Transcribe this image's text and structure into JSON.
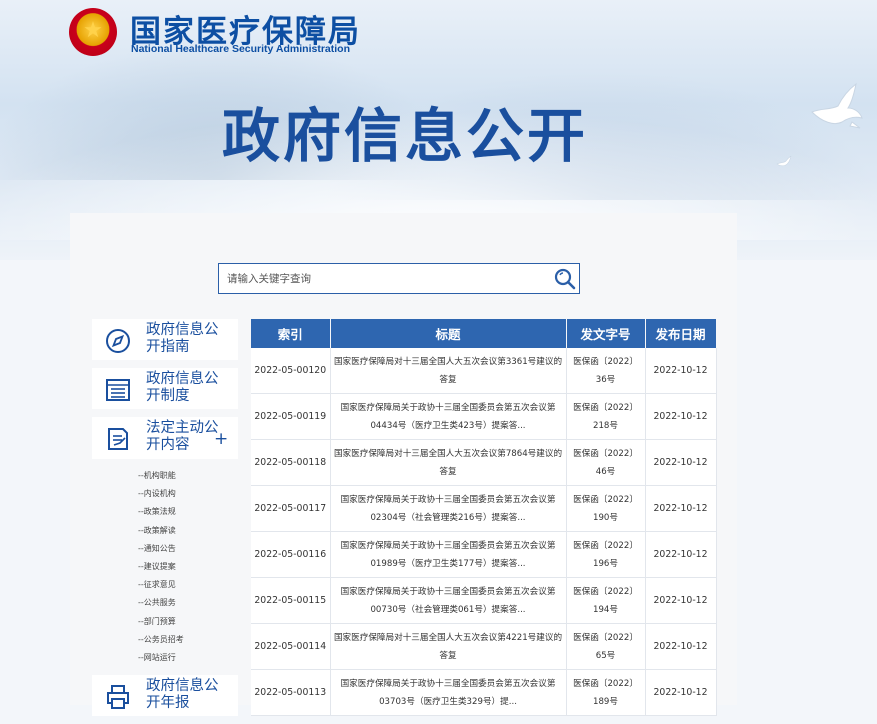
{
  "header": {
    "site_name_cn": "国家医疗保障局",
    "site_name_en": "National Healthcare Security Administration",
    "emblem_glyph": "★",
    "hero_title": "政府信息公开"
  },
  "search": {
    "placeholder": "请输入关键字查询",
    "icon": "search-icon"
  },
  "sidebar": {
    "items": [
      {
        "label": "政府信息公开指南",
        "icon": "compass-icon"
      },
      {
        "label": "政府信息公开制度",
        "icon": "list-doc-icon"
      },
      {
        "label": "法定主动公开内容",
        "icon": "edit-doc-icon",
        "expand": "+"
      },
      {
        "label": "政府信息公开年报",
        "icon": "print-doc-icon"
      }
    ],
    "sub_items": [
      "--机构职能",
      "--内设机构",
      "--政策法规",
      "--政策解读",
      "--通知公告",
      "--建议提案",
      "--征求意见",
      "--公共服务",
      "--部门预算",
      "--公务员招考",
      "--网站运行"
    ]
  },
  "table": {
    "headers": [
      "索引",
      "标题",
      "发文字号",
      "发布日期"
    ],
    "rows": [
      {
        "index": "2022-05-00120",
        "title": "国家医疗保障局对十三届全国人大五次会议第3361号建议的答复",
        "doc": "医保函〔2022〕36号",
        "date": "2022-10-12"
      },
      {
        "index": "2022-05-00119",
        "title": "国家医疗保障局关于政协十三届全国委员会第五次会议第04434号（医疗卫生类423号）提案答...",
        "doc": "医保函〔2022〕218号",
        "date": "2022-10-12"
      },
      {
        "index": "2022-05-00118",
        "title": "国家医疗保障局对十三届全国人大五次会议第7864号建议的答复",
        "doc": "医保函〔2022〕46号",
        "date": "2022-10-12"
      },
      {
        "index": "2022-05-00117",
        "title": "国家医疗保障局关于政协十三届全国委员会第五次会议第02304号（社会管理类216号）提案答...",
        "doc": "医保函〔2022〕190号",
        "date": "2022-10-12"
      },
      {
        "index": "2022-05-00116",
        "title": "国家医疗保障局关于政协十三届全国委员会第五次会议第01989号（医疗卫生类177号）提案答...",
        "doc": "医保函〔2022〕196号",
        "date": "2022-10-12"
      },
      {
        "index": "2022-05-00115",
        "title": "国家医疗保障局关于政协十三届全国委员会第五次会议第00730号（社会管理类061号）提案答...",
        "doc": "医保函〔2022〕194号",
        "date": "2022-10-12"
      },
      {
        "index": "2022-05-00114",
        "title": "国家医疗保障局对十三届全国人大五次会议第4221号建议的答复",
        "doc": "医保函〔2022〕65号",
        "date": "2022-10-12"
      },
      {
        "index": "2022-05-00113",
        "title": "国家医疗保障局关于政协十三届全国委员会第五次会议第03703号（医疗卫生类329号）提...",
        "doc": "医保函〔2022〕189号",
        "date": "2022-10-12"
      }
    ]
  },
  "colors": {
    "primary": "#1a4f9e",
    "table_header": "#2e66b0",
    "panel_bg": "#f6f7f9"
  }
}
